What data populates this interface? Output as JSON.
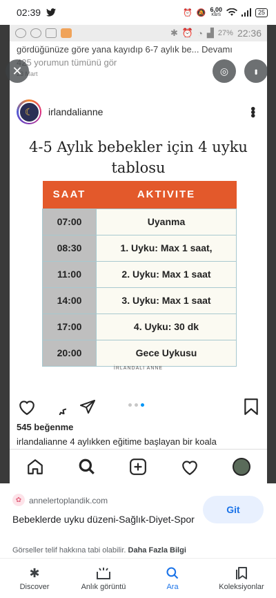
{
  "status_bar": {
    "time": "02:39",
    "net_speed": "6,00",
    "net_unit": "KB/S",
    "battery": "25"
  },
  "inner_status": {
    "battery_pct": "27%",
    "time": "22:36"
  },
  "post_top": {
    "caption_snippet": "gördüğünüze göre yana kayıdıp 6-7 aylık be... Devamı",
    "comments_link": "425 yorumun tümünü gör",
    "date": "23 Mart"
  },
  "post": {
    "username": "irlandalianne",
    "image_title": "4-5 Aylık bebekler için 4 uyku tablosu",
    "table_headers": [
      "SAAT",
      "AKTIVITE"
    ],
    "rows": [
      {
        "time": "07:00",
        "activity": "Uyanma"
      },
      {
        "time": "08:30",
        "activity": "1. Uyku: Max 1 saat,"
      },
      {
        "time": "11:00",
        "activity": "2. Uyku: Max 1 saat"
      },
      {
        "time": "14:00",
        "activity": "3. Uyku: Max 1 saat"
      },
      {
        "time": "17:00",
        "activity": "4. Uyku: 30 dk"
      },
      {
        "time": "20:00",
        "activity": "Gece Uykusu"
      }
    ],
    "brand": "İRLANDALI ANNE",
    "likes": "545 beğenme",
    "caption_user": "irlandalianne",
    "caption_text": " 4 aylıkken eğitime başlayan bir koala"
  },
  "result": {
    "source_domain": "annelertoplandik.com",
    "title": "Bebeklerde uyku düzeni-Sağlık-Diyet-Spor",
    "visit_label": "Git",
    "copyright": "Görseller telif hakkına tabi olabilir.",
    "more_info": "Daha Fazla Bilgi"
  },
  "bottom_nav": [
    {
      "label": "Discover",
      "icon": "asterisk-icon"
    },
    {
      "label": "Anlık görüntü",
      "icon": "snapshot-icon"
    },
    {
      "label": "Ara",
      "icon": "search-icon"
    },
    {
      "label": "Koleksiyonlar",
      "icon": "bookmark-icon"
    }
  ],
  "colors": {
    "table_header": "#e3592b",
    "accent": "#1a73e8",
    "carousel_active": "#0095f6"
  }
}
